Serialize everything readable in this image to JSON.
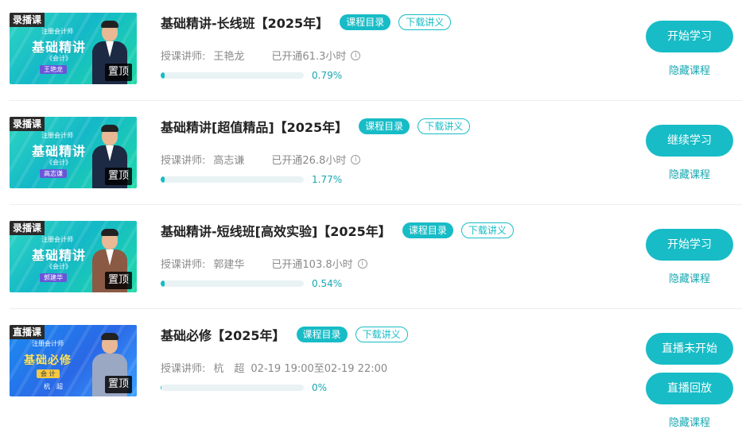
{
  "labels": {
    "catalog": "课程目录",
    "download": "下载讲义",
    "pinned": "置顶",
    "teacher_prefix": "授课讲师:",
    "hide": "隐藏课程",
    "subject": "《会计》",
    "live_subject": "会 计",
    "course_tag": "注册会计师",
    "thumb_title": "基础精讲",
    "live_thumb_title": "基础必修"
  },
  "courses": [
    {
      "type_label": "录播课",
      "title": "基础精讲-长线班【2025年】",
      "teacher": "王艳龙",
      "opened": "已开通61.3小时",
      "progress": 0.0079,
      "progress_text": "0.79%",
      "action": "开始学习"
    },
    {
      "type_label": "录播课",
      "title": "基础精讲[超值精品]【2025年】",
      "teacher": "高志谦",
      "opened": "已开通26.8小时",
      "progress": 0.0177,
      "progress_text": "1.77%",
      "action": "继续学习"
    },
    {
      "type_label": "录播课",
      "title": "基础精讲-短线班[高效实验]【2025年】",
      "teacher": "郭建华",
      "opened": "已开通103.8小时",
      "progress": 0.0054,
      "progress_text": "0.54%",
      "action": "开始学习"
    },
    {
      "type_label": "直播课",
      "title": "基础必修【2025年】",
      "teacher": "杭　超",
      "time": "02-19 19:00至02-19 22:00",
      "progress": 0,
      "progress_text": "0%",
      "action": "直播未开始",
      "action2": "直播回放"
    }
  ],
  "colors": {
    "accent": "#17bcc6",
    "accent_text": "#17a7b1"
  }
}
